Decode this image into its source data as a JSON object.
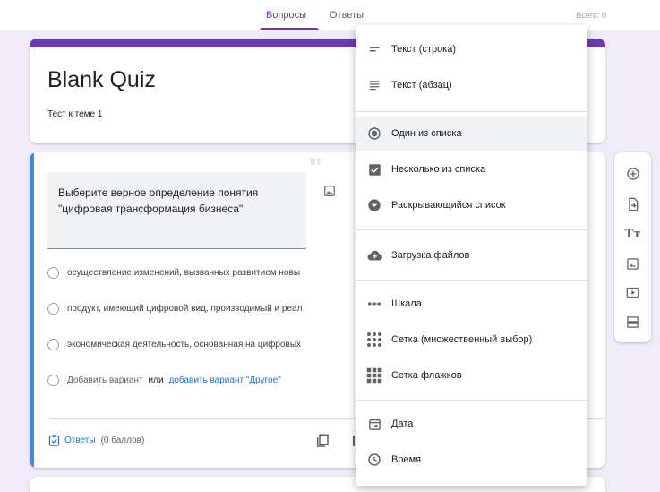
{
  "tabs": [
    {
      "label": "Вопросы",
      "active": true
    },
    {
      "label": "Ответы",
      "active": false
    }
  ],
  "total_label": "Всего: 0",
  "form": {
    "title": "Blank Quiz",
    "description": "Тест к теме 1"
  },
  "question": {
    "text_line1": "Выберите верное определение понятия",
    "text_line2": "\"цифровая трансформация бизнеса\"",
    "options": [
      "осуществление изменений, вызванных развитием новы",
      "продукт, имеющий цифровой вид, производимый и реал",
      "экономическая деятельность, основанная на цифровых"
    ],
    "add_option": "Добавить вариант",
    "add_or": "или",
    "add_other": "добавить вариант \"Другое\"",
    "answers_label": "Ответы",
    "points_label": "(0 баллов)"
  },
  "menu": {
    "items": [
      {
        "label": "Текст (строка)",
        "icon": "short-text-icon"
      },
      {
        "label": "Текст (абзац)",
        "icon": "paragraph-icon"
      },
      {
        "label": "Один из списка",
        "icon": "radio-button-icon",
        "selected": true
      },
      {
        "label": "Несколько из списка",
        "icon": "checkbox-icon"
      },
      {
        "label": "Раскрывающийся список",
        "icon": "dropdown-icon"
      },
      {
        "label": "Загрузка файлов",
        "icon": "cloud-upload-icon"
      },
      {
        "label": "Шкала",
        "icon": "linear-scale-icon"
      },
      {
        "label": "Сетка (множественный выбор)",
        "icon": "grid-dots-icon"
      },
      {
        "label": "Сетка флажков",
        "icon": "grid-squares-icon"
      },
      {
        "label": "Дата",
        "icon": "calendar-icon"
      },
      {
        "label": "Время",
        "icon": "clock-icon"
      }
    ]
  },
  "toolbar": {
    "tools": [
      "add-question-icon",
      "import-questions-icon",
      "add-title-icon",
      "add-image-icon",
      "add-video-icon",
      "add-section-icon"
    ]
  },
  "colors": {
    "accent": "#673ab7",
    "blue": "#1a73e8",
    "background": "#f0ebf8"
  }
}
